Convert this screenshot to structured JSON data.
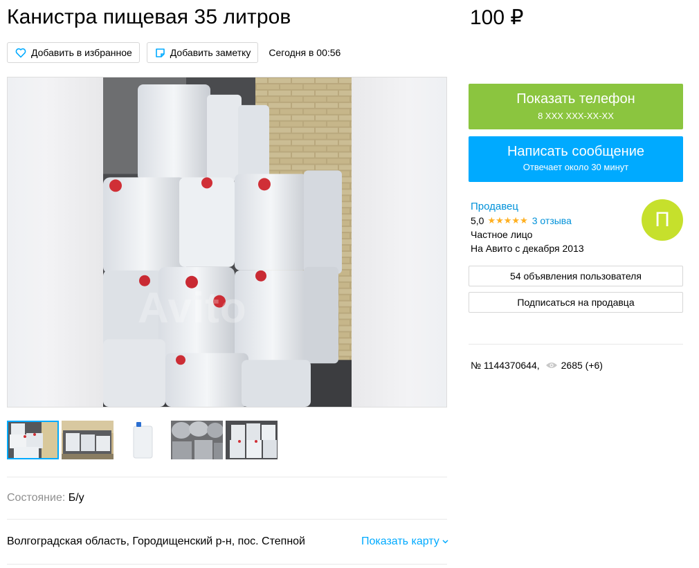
{
  "listing": {
    "title": "Канистра пищевая 35 литров",
    "price": "100 ₽"
  },
  "actions": {
    "favorite_label": "Добавить в избранное",
    "note_label": "Добавить заметку",
    "date": "Сегодня в 00:56"
  },
  "gallery": {
    "watermark": "Avito",
    "thumbnail_count": 5,
    "active_index": 0
  },
  "details": {
    "condition_label": "Состояние:",
    "condition_value": "Б/у",
    "address": "Волгоградская область, Городищенский р-н, пос. Степной",
    "map_link": "Показать карту"
  },
  "contact": {
    "phone_label": "Показать телефон",
    "phone_masked": "8 XXX XXX-XX-XX",
    "message_label": "Написать сообщение",
    "message_sub": "Отвечает около 30 минут"
  },
  "seller": {
    "name": "Продавец",
    "rating": "5,0",
    "stars": "★★★★★",
    "reviews": "3 отзыва",
    "type": "Частное лицо",
    "since": "На Авито с декабря 2013",
    "avatar_letter": "П",
    "avatar_color": "#c6e02c",
    "ads_button": "54 объявления пользователя",
    "subscribe_button": "Подписаться на продавца"
  },
  "stats": {
    "ad_number": "№ 1144370644,",
    "views": "2685 (+6)"
  },
  "colors": {
    "phone_button": "#8bc53f",
    "message_button": "#00aaff",
    "link": "#0091d9",
    "stars": "#ffb021"
  }
}
